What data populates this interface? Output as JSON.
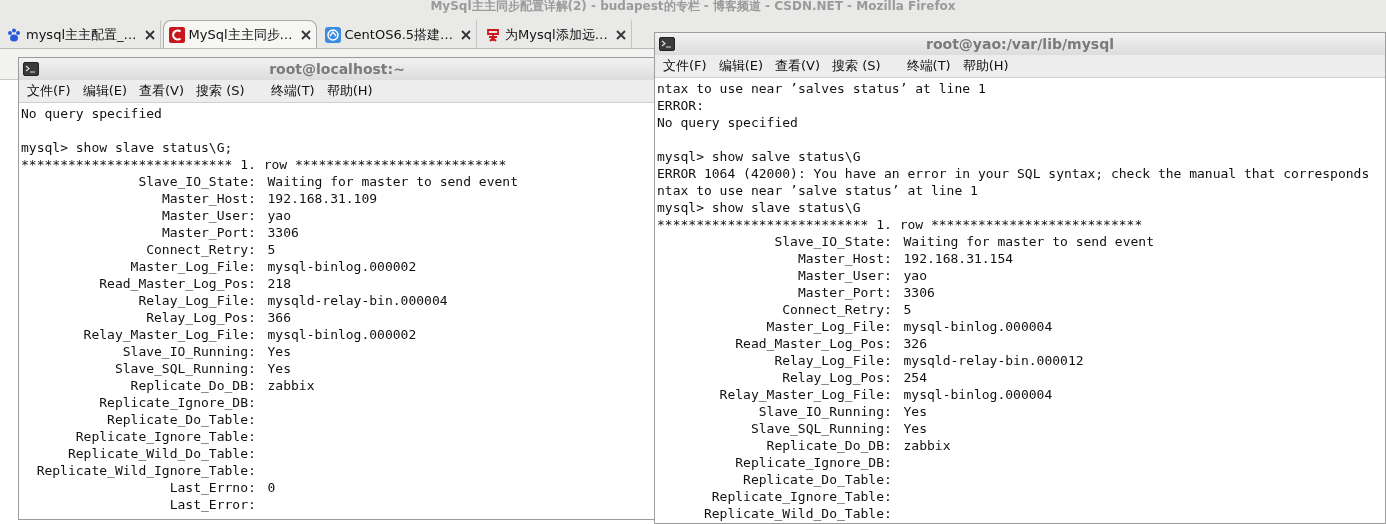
{
  "browser": {
    "title": "MySql主主同步配置详解(2) - budapest的专栏 - 博客频道 - CSDN.NET - Mozilla Firefox",
    "tabs": [
      {
        "title": "mysql主主配置_…",
        "selected": false,
        "kind": "paw"
      },
      {
        "title": "MySql主主同步…",
        "selected": true,
        "kind": "letter"
      },
      {
        "title": "CentOS6.5搭建…",
        "selected": false,
        "kind": "ring"
      },
      {
        "title": "为Mysql添加远…",
        "selected": false,
        "kind": "seal"
      }
    ]
  },
  "terminals": [
    {
      "title": "root@localhost:~",
      "menu": [
        "文件(F)",
        "编辑(E)",
        "查看(V)",
        "搜索 (S)",
        "终端(T)",
        "帮助(H)"
      ],
      "lines": [
        {
          "kind": "text",
          "text": "No query specified"
        },
        {
          "kind": "blank"
        },
        {
          "kind": "text",
          "text": "mysql> show slave status\\G;"
        },
        {
          "kind": "text",
          "text": "*************************** 1. row ***************************"
        },
        {
          "kind": "field",
          "name": "Slave_IO_State:",
          "value": "Waiting for master to send event"
        },
        {
          "kind": "field",
          "name": "Master_Host:",
          "value": "192.168.31.109"
        },
        {
          "kind": "field",
          "name": "Master_User:",
          "value": "yao"
        },
        {
          "kind": "field",
          "name": "Master_Port:",
          "value": "3306"
        },
        {
          "kind": "field",
          "name": "Connect_Retry:",
          "value": "5"
        },
        {
          "kind": "field",
          "name": "Master_Log_File:",
          "value": "mysql-binlog.000002"
        },
        {
          "kind": "field",
          "name": "Read_Master_Log_Pos:",
          "value": "218"
        },
        {
          "kind": "field",
          "name": "Relay_Log_File:",
          "value": "mysqld-relay-bin.000004"
        },
        {
          "kind": "field",
          "name": "Relay_Log_Pos:",
          "value": "366"
        },
        {
          "kind": "field",
          "name": "Relay_Master_Log_File:",
          "value": "mysql-binlog.000002"
        },
        {
          "kind": "field",
          "name": "Slave_IO_Running:",
          "value": "Yes"
        },
        {
          "kind": "field",
          "name": "Slave_SQL_Running:",
          "value": "Yes"
        },
        {
          "kind": "field",
          "name": "Replicate_Do_DB:",
          "value": "zabbix"
        },
        {
          "kind": "field",
          "name": "Replicate_Ignore_DB:"
        },
        {
          "kind": "field",
          "name": "Replicate_Do_Table:"
        },
        {
          "kind": "field",
          "name": "Replicate_Ignore_Table:"
        },
        {
          "kind": "field",
          "name": "Replicate_Wild_Do_Table:"
        },
        {
          "kind": "field",
          "name": "Replicate_Wild_Ignore_Table:"
        },
        {
          "kind": "field",
          "name": "Last_Errno:",
          "value": "0"
        },
        {
          "kind": "field",
          "name": "Last_Error:"
        }
      ]
    },
    {
      "title": "root@yao:/var/lib/mysql",
      "menu": [
        "文件(F)",
        "编辑(E)",
        "查看(V)",
        "搜索 (S)",
        "终端(T)",
        "帮助(H)"
      ],
      "lines": [
        {
          "kind": "text",
          "text": "ntax to use near ’salves status’ at line 1"
        },
        {
          "kind": "text",
          "text": "ERROR:"
        },
        {
          "kind": "text",
          "text": "No query specified"
        },
        {
          "kind": "blank"
        },
        {
          "kind": "text",
          "text": "mysql> show salve status\\G"
        },
        {
          "kind": "text",
          "text": "ERROR 1064 (42000): You have an error in your SQL syntax; check the manual that corresponds"
        },
        {
          "kind": "text",
          "text": "ntax to use near ’salve status’ at line 1"
        },
        {
          "kind": "text",
          "text": "mysql> show slave status\\G"
        },
        {
          "kind": "text",
          "text": "*************************** 1. row ***************************"
        },
        {
          "kind": "field",
          "name": "Slave_IO_State:",
          "value": "Waiting for master to send event"
        },
        {
          "kind": "field",
          "name": "Master_Host:",
          "value": "192.168.31.154"
        },
        {
          "kind": "field",
          "name": "Master_User:",
          "value": "yao"
        },
        {
          "kind": "field",
          "name": "Master_Port:",
          "value": "3306"
        },
        {
          "kind": "field",
          "name": "Connect_Retry:",
          "value": "5"
        },
        {
          "kind": "field",
          "name": "Master_Log_File:",
          "value": "mysql-binlog.000004"
        },
        {
          "kind": "field",
          "name": "Read_Master_Log_Pos:",
          "value": "326"
        },
        {
          "kind": "field",
          "name": "Relay_Log_File:",
          "value": "mysqld-relay-bin.000012"
        },
        {
          "kind": "field",
          "name": "Relay_Log_Pos:",
          "value": "254"
        },
        {
          "kind": "field",
          "name": "Relay_Master_Log_File:",
          "value": "mysql-binlog.000004"
        },
        {
          "kind": "field",
          "name": "Slave_IO_Running:",
          "value": "Yes"
        },
        {
          "kind": "field",
          "name": "Slave_SQL_Running:",
          "value": "Yes"
        },
        {
          "kind": "field",
          "name": "Replicate_Do_DB:",
          "value": "zabbix"
        },
        {
          "kind": "field",
          "name": "Replicate_Ignore_DB:"
        },
        {
          "kind": "field",
          "name": "Replicate_Do_Table:"
        },
        {
          "kind": "field",
          "name": "Replicate_Ignore_Table:"
        },
        {
          "kind": "field",
          "name": "Replicate_Wild_Do_Table:"
        }
      ]
    }
  ]
}
